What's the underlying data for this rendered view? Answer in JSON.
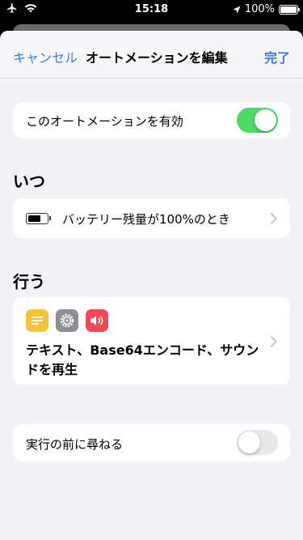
{
  "status_bar": {
    "time": "15:18",
    "battery_percent": "100%"
  },
  "nav": {
    "cancel": "キャンセル",
    "title": "オートメーションを編集",
    "done": "完了"
  },
  "enable_row": {
    "label": "このオートメーションを有効",
    "toggle_on": true
  },
  "when_section": {
    "header": "いつ",
    "trigger_label": "バッテリー残量が100%のとき"
  },
  "do_section": {
    "header": "行う",
    "icons": [
      "text-icon",
      "gear-icon",
      "sound-icon"
    ],
    "actions_label": "テキスト、Base64エンコード、サウンドを再生"
  },
  "ask_row": {
    "label": "実行の前に尋ねる",
    "toggle_on": false
  },
  "colors": {
    "accent": "#2f7cf6",
    "toggle_on": "#4cd964",
    "text_icon": "#f5c338",
    "gear_icon": "#8e8e93",
    "sound_icon": "#f24957"
  }
}
